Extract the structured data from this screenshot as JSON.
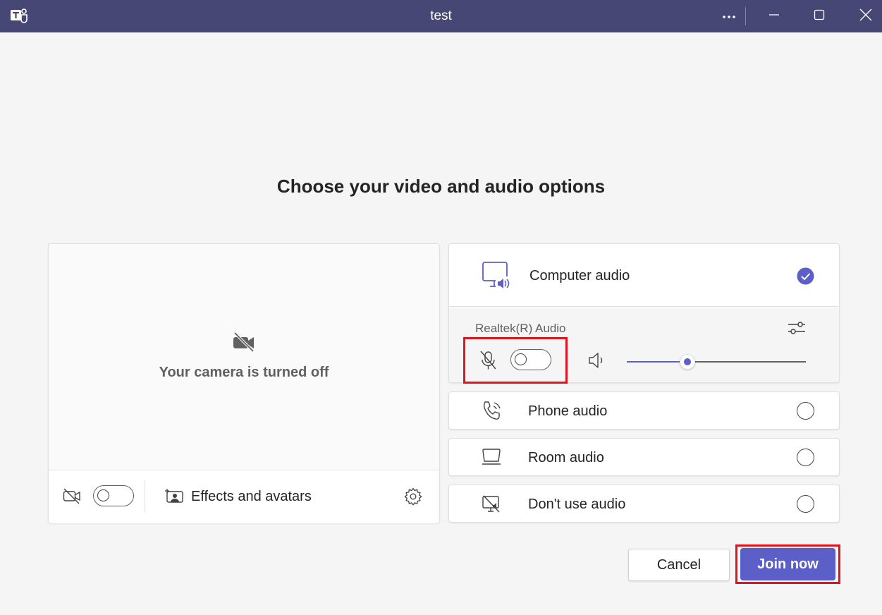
{
  "window": {
    "title": "test",
    "app_icon": "teams-icon",
    "controls": [
      "more-options-icon",
      "minimize-icon",
      "maximize-icon",
      "close-icon"
    ]
  },
  "heading": "Choose your video and audio options",
  "camera": {
    "status_text": "Your camera is turned off",
    "toggle_on": false,
    "effects_label": "Effects and avatars"
  },
  "audio": {
    "computer_audio": {
      "label": "Computer audio",
      "selected": true,
      "device_name": "Realtek(R) Audio",
      "mic_on": false,
      "volume": 0.34
    },
    "options": [
      {
        "label": "Phone audio",
        "selected": false,
        "icon": "phone-audio-icon"
      },
      {
        "label": "Room audio",
        "selected": false,
        "icon": "room-audio-icon"
      },
      {
        "label": "Don't use audio",
        "selected": false,
        "icon": "no-audio-icon"
      }
    ]
  },
  "buttons": {
    "cancel": "Cancel",
    "join": "Join now"
  },
  "colors": {
    "titlebar": "#464775",
    "accent": "#5b5fc7",
    "highlight": "#e0141f"
  }
}
